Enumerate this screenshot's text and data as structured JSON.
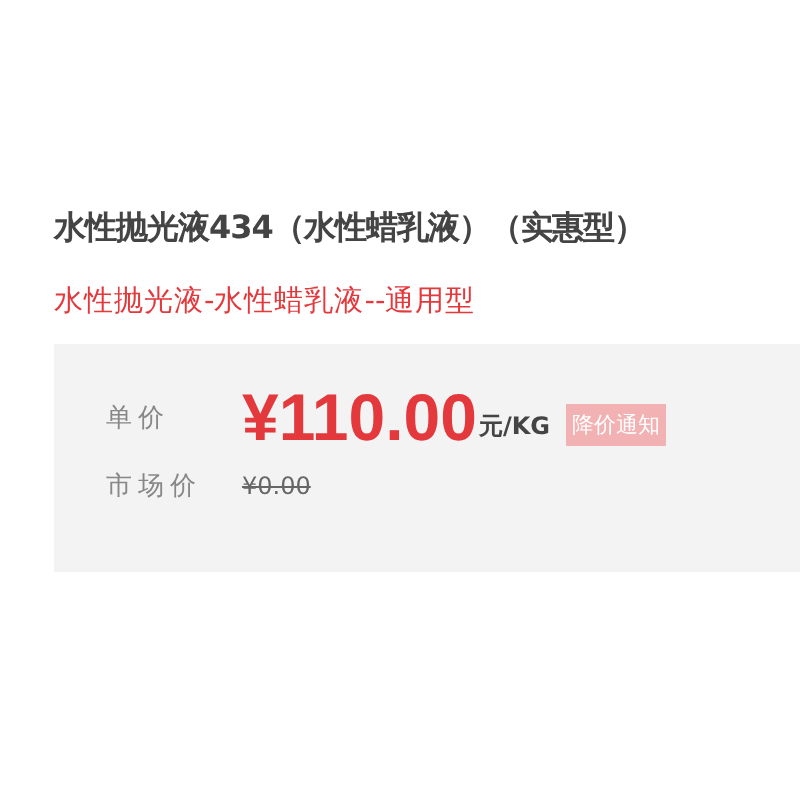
{
  "product": {
    "title": "水性抛光液434（水性蜡乳液）（实惠型）",
    "subtitle": "水性抛光液-水性蜡乳液--通用型"
  },
  "price_panel": {
    "price_label": "单价",
    "price": "¥110.00",
    "unit": "元/KG",
    "notify_button": "降价通知",
    "market_label": "市场价",
    "market_price": "¥0.00"
  }
}
